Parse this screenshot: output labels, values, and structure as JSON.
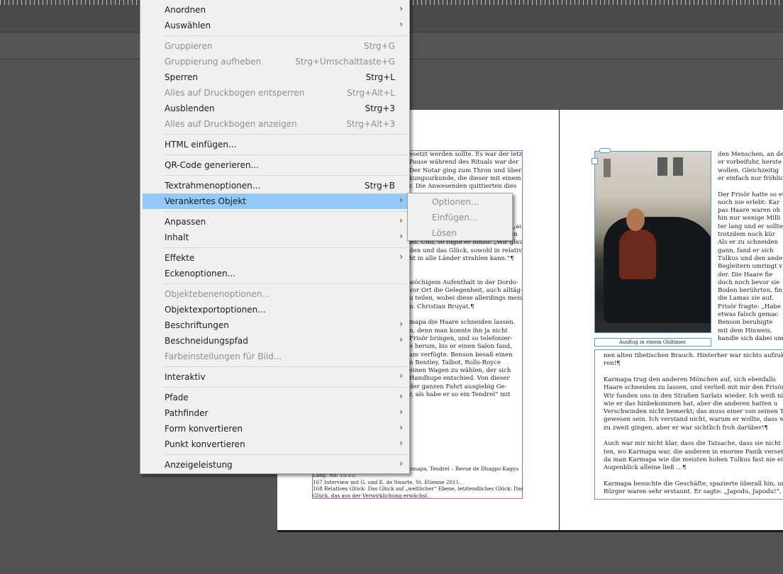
{
  "menu": {
    "items": [
      {
        "label": "Anordnen",
        "shortcut": "",
        "submenu": true,
        "disabled": false
      },
      {
        "label": "Auswählen",
        "shortcut": "",
        "submenu": true,
        "disabled": false
      },
      {
        "label": "Gruppieren",
        "shortcut": "Strg+G",
        "submenu": false,
        "disabled": true
      },
      {
        "label": "Gruppierung aufheben",
        "shortcut": "Strg+Umschalttaste+G",
        "submenu": false,
        "disabled": true
      },
      {
        "label": "Sperren",
        "shortcut": "Strg+L",
        "submenu": false,
        "disabled": false
      },
      {
        "label": "Alles auf Druckbogen entsperren",
        "shortcut": "Strg+Alt+L",
        "submenu": false,
        "disabled": true
      },
      {
        "label": "Ausblenden",
        "shortcut": "Strg+3",
        "submenu": false,
        "disabled": false
      },
      {
        "label": "Alles auf Druckbogen anzeigen",
        "shortcut": "Strg+Alt+3",
        "submenu": false,
        "disabled": true
      },
      {
        "label": "HTML einfügen...",
        "shortcut": "",
        "submenu": false,
        "disabled": false
      },
      {
        "label": "QR-Code generieren...",
        "shortcut": "",
        "submenu": false,
        "disabled": false
      },
      {
        "label": "Textrahmenoptionen...",
        "shortcut": "Strg+B",
        "submenu": false,
        "disabled": false
      },
      {
        "label": "Verankertes Objekt",
        "shortcut": "",
        "submenu": true,
        "disabled": false,
        "highlighted": true
      },
      {
        "label": "Anpassen",
        "shortcut": "",
        "submenu": true,
        "disabled": false
      },
      {
        "label": "Inhalt",
        "shortcut": "",
        "submenu": true,
        "disabled": false
      },
      {
        "label": "Effekte",
        "shortcut": "",
        "submenu": true,
        "disabled": false
      },
      {
        "label": "Eckenoptionen...",
        "shortcut": "",
        "submenu": false,
        "disabled": false
      },
      {
        "label": "Objektebenenoptionen...",
        "shortcut": "",
        "submenu": false,
        "disabled": true
      },
      {
        "label": "Objektexportoptionen...",
        "shortcut": "",
        "submenu": false,
        "disabled": false
      },
      {
        "label": "Beschriftungen",
        "shortcut": "",
        "submenu": true,
        "disabled": false
      },
      {
        "label": "Beschneidungspfad",
        "shortcut": "",
        "submenu": true,
        "disabled": false
      },
      {
        "label": "Farbeinstellungen für Bild...",
        "shortcut": "",
        "submenu": false,
        "disabled": true
      },
      {
        "label": "Interaktiv",
        "shortcut": "",
        "submenu": true,
        "disabled": false
      },
      {
        "label": "Pfade",
        "shortcut": "",
        "submenu": true,
        "disabled": false
      },
      {
        "label": "Pathfinder",
        "shortcut": "",
        "submenu": true,
        "disabled": false
      },
      {
        "label": "Form konvertieren",
        "shortcut": "",
        "submenu": true,
        "disabled": false
      },
      {
        "label": "Punkt konvertieren",
        "shortcut": "",
        "submenu": true,
        "disabled": false
      },
      {
        "label": "Anzeigeleistung",
        "shortcut": "",
        "submenu": true,
        "disabled": false
      }
    ]
  },
  "submenu": {
    "items": [
      {
        "label": "Optionen...",
        "disabled": true
      },
      {
        "label": "Einfügen...",
        "disabled": true
      },
      {
        "label": "Lösen",
        "disabled": true
      }
    ]
  },
  "document": {
    "left_lines": [
      "esetzt werden sollte. Es war der letz-",
      "Pause während des Rituals war der",
      "Der Notar ging zum Thron und über-",
      "kungsurkunde, die dieser mit einem",
      "r. Die Anwesenden quittierten dies",
      "",
      "",
      "",
      "",
      "ücklich, dass die Schenkung nun „auf",
      "en stand“, wodurch „alle künftigen",
      "en. Und, so fügte er hinzu: „Wir glau-",
      "den und das Glück, sowohl in relativer",
      "ht in alle Länder strahlen kann.“¶",
      "",
      "",
      "wöchigem Aufenthalt in der Dordo-",
      "vor Ort die Gelegenheit, auch alltäg-",
      "u teilen, wobei diese allerdings meist",
      "n. Christian Bruyat.¶",
      "",
      "mapa die Haare schneiden lassen.",
      "n, denn man konnte ihn ja nicht",
      "Frisör bringen, und so telefonier-",
      "e herum, bis er einen Salon fand,",
      "am verfügte. Benson besaß einen",
      "n Bentley, Talbot, Rolls-Royce",
      "einen Wagen zu wählen, der sich",
      "Handhupe entschied. Von dieser",
      "der ganzen Fahrt ausgiebig Ge-",
      "r, als habe er so ein Tendrel“ mit"
    ],
    "footnotes": [
      "Lang. No. 15-15.",
      "167 Interview mit G. und E. de Swarte, St. Etienne 2011.",
      "168 Relatives Glück: Das Glück auf „weltlicher“ Ebene, letztendliches Glück: Das",
      "Glück, das aus der Verwirklichung erwächst."
    ],
    "footnote_partial": "rmapa, Tendrel – Revue de Dhagpo Kagyu",
    "right_side_lines": [
      "den Menschen, an de",
      "er vorbeifuhr, herste",
      "wollen. Gleichzeitig",
      "er einfach nur fröhlic",
      "",
      "Der Frisör hatte so et",
      "noch nie erlebt: Kar",
      "pas Haare waren oh",
      "hin nur wenige Milli",
      "ter lang und er sollte",
      "trotzdem noch kür",
      "Als er zu schneiden",
      "gann, fand er sich",
      "Tulkus und den ande",
      "Begleitern umringt v",
      "der. Die Haare fie",
      "doch noch bevor sie",
      "Boden berührten, fin",
      "die Lamas sie auf.",
      "Frisör fragte: „Habe",
      "etwas falsch gemac",
      "Benson beruhigte",
      "mit dem Hinweis,",
      "handle sich dabei um"
    ],
    "caption": "Ausflug in einem Oldtimer.",
    "right_lines": [
      "nen alten tibetischen Brauch. Hinterher war nichts aufzuk",
      "ren!¶",
      "",
      "Karmapa trug den anderen Mönchen auf, sich ebenfalls",
      "Haare schneiden zu lassen, und verließ mit mir den Frisörsal",
      "Wir fanden uns in den Straßen Sarlats wieder. Ich weiß nic",
      "wie er das hinbekommen hat, aber die anderen hatten u",
      "Verschwinden nicht bemerkt; das muss einer von seinen Tri",
      "gewesen sein. Ich verstand nicht, warum er wollte, dass wir",
      "zu zweit gingen, aber er war sichtlich froh darüber!¶",
      "",
      "Auch war mir nicht klar, dass die Tatsache, dass sie nicht wu",
      "ten, wo Karmapa war, die anderen in enorme Panik verset",
      "da man Karmapa wie die meisten hohen Tulkus fast nie ei",
      "Augenblick alleine ließ …¶",
      "",
      "Karmapa besuchte die Geschäfte, spazierte überall hin, und",
      "Bürger waren sehr erstaunt. Er sagte: „Japodu, Japodu!“, „s"
    ]
  }
}
